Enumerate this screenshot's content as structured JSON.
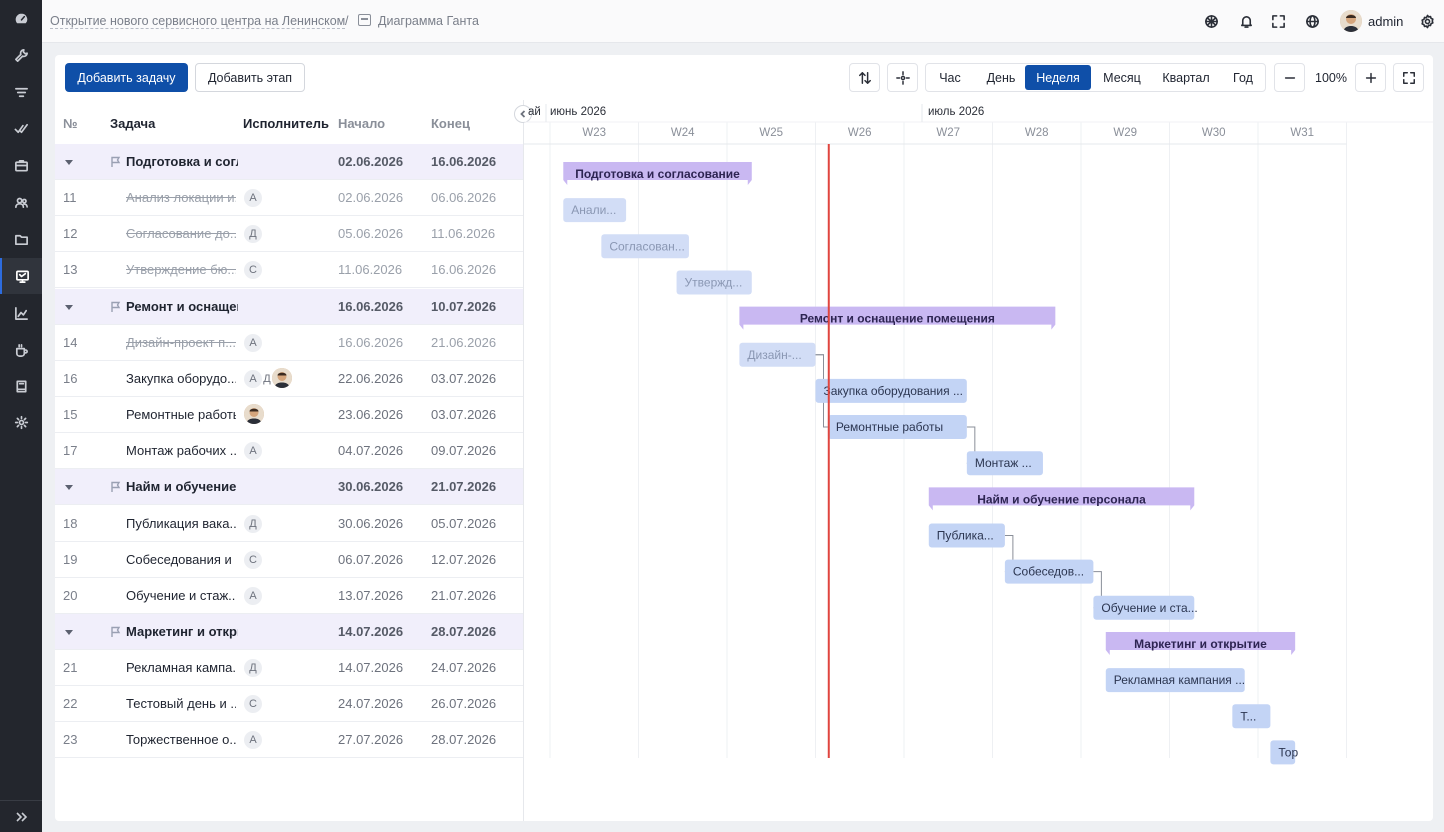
{
  "breadcrumb": {
    "project": "Открытие нового сервисного центра на Ленинском",
    "separator": "/",
    "page": "Диаграмма Ганта"
  },
  "user": {
    "name": "admin"
  },
  "sidebar": {
    "items": [
      {
        "icon": "dashboard-icon"
      },
      {
        "icon": "wrench-icon"
      },
      {
        "icon": "filter-icon"
      },
      {
        "icon": "checks-icon"
      },
      {
        "icon": "briefcase-icon"
      },
      {
        "icon": "users-icon"
      },
      {
        "icon": "folder-icon"
      },
      {
        "icon": "gantt-icon",
        "active": true
      },
      {
        "icon": "chart-icon"
      },
      {
        "icon": "coffee-icon"
      },
      {
        "icon": "book-icon"
      },
      {
        "icon": "gear-icon"
      }
    ]
  },
  "toolbar": {
    "add_task": "Добавить задачу",
    "add_stage": "Добавить этап",
    "scales": [
      "Час",
      "День",
      "Неделя",
      "Месяц",
      "Квартал",
      "Год"
    ],
    "active_scale": "Неделя",
    "zoom": "100%"
  },
  "table": {
    "headers": {
      "num": "№",
      "task": "Задача",
      "assignee": "Исполнитель",
      "start": "Начало",
      "end": "Конец"
    },
    "rows": [
      {
        "type": "stage",
        "task": "Подготовка и согласование",
        "start": "02.06.2026",
        "end": "16.06.2026"
      },
      {
        "type": "task",
        "num": "11",
        "task": "Анализ локации и...",
        "assignees": [
          "А"
        ],
        "start": "02.06.2026",
        "end": "06.06.2026",
        "done": true
      },
      {
        "type": "task",
        "num": "12",
        "task": "Согласование до...",
        "assignees": [
          "Д"
        ],
        "start": "05.06.2026",
        "end": "11.06.2026",
        "done": true
      },
      {
        "type": "task",
        "num": "13",
        "task": "Утверждение бю...",
        "assignees": [
          "С"
        ],
        "start": "11.06.2026",
        "end": "16.06.2026",
        "done": true
      },
      {
        "type": "stage",
        "task": "Ремонт и оснащение помещения",
        "start": "16.06.2026",
        "end": "10.07.2026"
      },
      {
        "type": "task",
        "num": "14",
        "task": "Дизайн-проект п...",
        "assignees": [
          "А"
        ],
        "start": "16.06.2026",
        "end": "21.06.2026",
        "done": true
      },
      {
        "type": "task",
        "num": "16",
        "task": "Закупка оборудо...",
        "assignees": [
          "А",
          "Д",
          "photo"
        ],
        "start": "22.06.2026",
        "end": "03.07.2026",
        "done": false
      },
      {
        "type": "task",
        "num": "15",
        "task": "Ремонтные работы",
        "assignees": [
          "photo"
        ],
        "start": "23.06.2026",
        "end": "03.07.2026",
        "done": false
      },
      {
        "type": "task",
        "num": "17",
        "task": "Монтаж рабочих ...",
        "assignees": [
          "А"
        ],
        "start": "04.07.2026",
        "end": "09.07.2026",
        "done": false
      },
      {
        "type": "stage",
        "task": "Найм и обучение персонала",
        "start": "30.06.2026",
        "end": "21.07.2026"
      },
      {
        "type": "task",
        "num": "18",
        "task": "Публикация вака...",
        "assignees": [
          "Д"
        ],
        "start": "30.06.2026",
        "end": "05.07.2026",
        "done": false
      },
      {
        "type": "task",
        "num": "19",
        "task": "Собеседования и ...",
        "assignees": [
          "С"
        ],
        "start": "06.07.2026",
        "end": "12.07.2026",
        "done": false
      },
      {
        "type": "task",
        "num": "20",
        "task": "Обучение и стаж...",
        "assignees": [
          "А"
        ],
        "start": "13.07.2026",
        "end": "21.07.2026",
        "done": false
      },
      {
        "type": "stage",
        "task": "Маркетинг и открытие",
        "start": "14.07.2026",
        "end": "28.07.2026"
      },
      {
        "type": "task",
        "num": "21",
        "task": "Рекламная кампа...",
        "assignees": [
          "Д"
        ],
        "start": "14.07.2026",
        "end": "24.07.2026",
        "done": false
      },
      {
        "type": "task",
        "num": "22",
        "task": "Тестовый день и ...",
        "assignees": [
          "С"
        ],
        "start": "24.07.2026",
        "end": "26.07.2026",
        "done": false
      },
      {
        "type": "task",
        "num": "23",
        "task": "Торжественное о...",
        "assignees": [
          "А"
        ],
        "start": "27.07.2026",
        "end": "28.07.2026",
        "done": false
      }
    ]
  },
  "gantt": {
    "months": [
      {
        "label": "ай"
      },
      {
        "label": "июнь 2026"
      },
      {
        "label": "июль 2026"
      }
    ],
    "weeks": [
      "W23",
      "W24",
      "W25",
      "W26",
      "W27",
      "W28",
      "W29",
      "W30",
      "W31"
    ],
    "today_week_fraction": 3.15,
    "bars": [
      {
        "label": "Подготовка и согласование",
        "type": "stage",
        "row": 0,
        "w0": 0.15,
        "w1": 2.28
      },
      {
        "label": "Анали...",
        "type": "done",
        "row": 1,
        "w0": 0.15,
        "w1": 0.86
      },
      {
        "label": "Согласован...",
        "type": "done",
        "row": 2,
        "w0": 0.58,
        "w1": 1.57
      },
      {
        "label": "Утвержд...",
        "type": "done",
        "row": 3,
        "w0": 1.43,
        "w1": 2.28
      },
      {
        "label": "Ремонт и оснащение помещения",
        "type": "stage",
        "row": 4,
        "w0": 2.14,
        "w1": 5.71
      },
      {
        "label": "Дизайн-...",
        "type": "done",
        "row": 5,
        "w0": 2.14,
        "w1": 3.0
      },
      {
        "label": "Закупка оборудования ...",
        "type": "task",
        "row": 6,
        "w0": 3.0,
        "w1": 4.71
      },
      {
        "label": "Ремонтные работы",
        "type": "task",
        "row": 7,
        "w0": 3.14,
        "w1": 4.71
      },
      {
        "label": "Монтаж ...",
        "type": "task",
        "row": 8,
        "w0": 4.71,
        "w1": 5.57
      },
      {
        "label": "Найм и обучение персонала",
        "type": "stage",
        "row": 9,
        "w0": 4.28,
        "w1": 7.28
      },
      {
        "label": "Публика...",
        "type": "task",
        "row": 10,
        "w0": 4.28,
        "w1": 5.14
      },
      {
        "label": "Собеседов...",
        "type": "task",
        "row": 11,
        "w0": 5.14,
        "w1": 6.14
      },
      {
        "label": "Обучение и ста...",
        "type": "task",
        "row": 12,
        "w0": 6.14,
        "w1": 7.28
      },
      {
        "label": "Маркетинг и открытие",
        "type": "stage",
        "row": 13,
        "w0": 6.28,
        "w1": 8.42
      },
      {
        "label": "Рекламная кампания ...",
        "type": "task",
        "row": 14,
        "w0": 6.28,
        "w1": 7.85
      },
      {
        "label": "Т...",
        "type": "task",
        "row": 15,
        "w0": 7.71,
        "w1": 8.14
      },
      {
        "label": "Тор",
        "type": "task",
        "row": 16,
        "w0": 8.14,
        "w1": 8.42
      }
    ],
    "links": [
      [
        5,
        6
      ],
      [
        5,
        7
      ],
      [
        7,
        8
      ],
      [
        10,
        11
      ],
      [
        11,
        12
      ]
    ],
    "colors": {
      "stage": "#c9b8f2",
      "task": "#c3d4f5",
      "done": "#d2ddf6",
      "today": "#e0453f",
      "grid": "#eef0f3"
    }
  }
}
